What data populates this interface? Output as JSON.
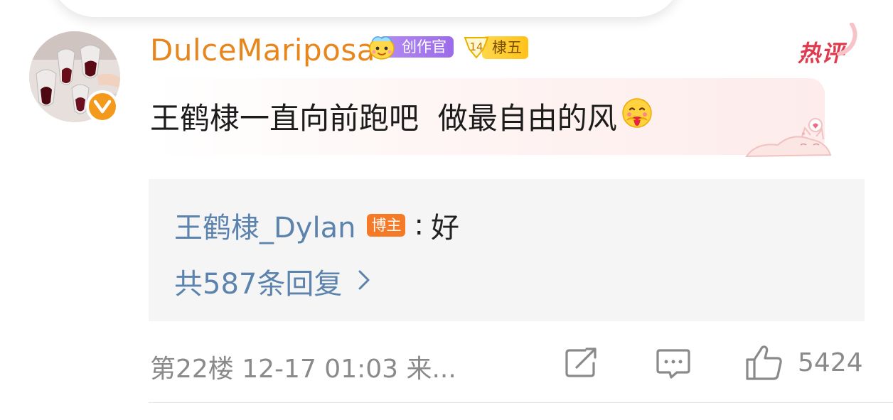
{
  "comment": {
    "username": "DulceMariposa",
    "badges": {
      "creator": "创作官",
      "floor_level": "14",
      "floor_label": "棣五"
    },
    "hot_tag": "热评",
    "text": "王鹤棣一直向前跑吧  做最自由的风",
    "reply_preview": {
      "author": "王鹤棣_Dylan",
      "badge": "博主",
      "colon": ":",
      "text": "好"
    },
    "replies_link": "共587条回复",
    "meta": "第22楼 12-17 01:03 来...",
    "likes": "5424"
  },
  "colors": {
    "username": "#e8861e",
    "link_blue": "#5b83ad",
    "hot_red": "#e03a4e",
    "verified_orange": "#f39a1c",
    "creator_purple": "#9b6bea",
    "floor_yellow": "#ffc21a",
    "blogger_orange": "#f57a28",
    "meta_gray": "#8a8a8a"
  },
  "icons": {
    "verified": "verified-v-icon",
    "creator_badge": "creator-mascot-icon",
    "floor_badge": "floor-badge-icon",
    "comment_emoji": "hug-love-emoji",
    "chevron": "chevron-right-icon",
    "share": "share-icon",
    "reply": "comment-icon",
    "like": "thumbs-up-icon"
  }
}
